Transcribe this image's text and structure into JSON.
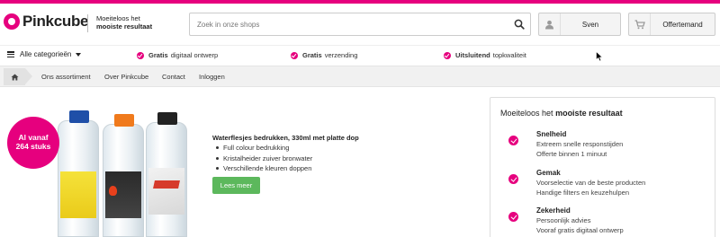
{
  "colors": {
    "accent": "#e6007e",
    "button_green": "#5cb85c"
  },
  "header": {
    "logo_text": "Pinkcube",
    "tagline_line1": "Moeiteloos het",
    "tagline_line2": "mooiste resultaat",
    "search": {
      "placeholder": "Zoek in onze shops",
      "icon": "search-icon"
    },
    "account_label": "Sven",
    "account_icon": "user-icon",
    "quote_label": "Offertemand",
    "quote_icon": "cart-icon"
  },
  "usp_bar": {
    "category_label": "Alle categorieën",
    "usps": [
      {
        "bold": "Gratis",
        "text": "digitaal ontwerp"
      },
      {
        "bold": "Gratis",
        "text": "verzending"
      },
      {
        "bold": "Uitsluitend",
        "text": "topkwaliteit"
      }
    ]
  },
  "breadcrumb": {
    "home_icon": "home-icon",
    "links": [
      "Ons assortiment",
      "Over Pinkcube",
      "Contact",
      "Inloggen"
    ]
  },
  "hero": {
    "badge_line1": "Al vanaf",
    "badge_line2": "264 stuks",
    "title": "Waterflesjes bedrukken, 330ml met platte dop",
    "bullets": [
      "Full colour bedrukking",
      "Kristalheider zuiver bronwater",
      "Verschillende kleuren doppen"
    ],
    "button_label": "Lees meer"
  },
  "side_panel": {
    "title_normal": "Moeiteloos het",
    "title_bold": "mooiste resultaat",
    "features": [
      {
        "title": "Snelheid",
        "lines": [
          "Extreem snelle responstijden",
          "Offerte binnen 1 minuut"
        ]
      },
      {
        "title": "Gemak",
        "lines": [
          "Voorselectie van de beste producten",
          "Handige filters en keuzehulpen"
        ]
      },
      {
        "title": "Zekerheid",
        "lines": [
          "Persoonlijk advies",
          "Vooraf gratis digitaal ontwerp"
        ]
      }
    ]
  }
}
